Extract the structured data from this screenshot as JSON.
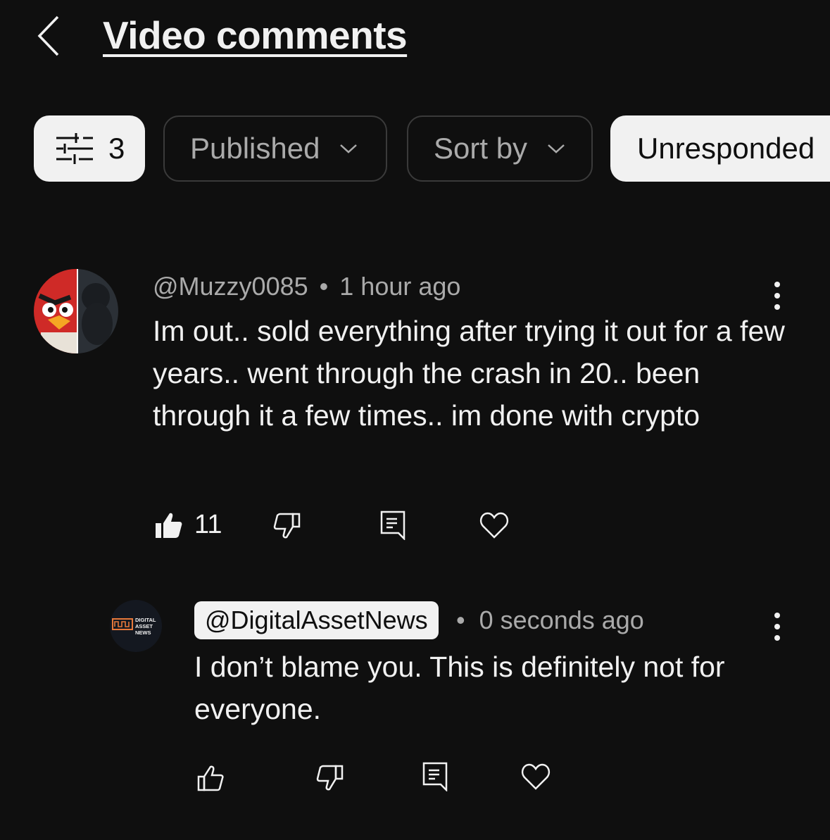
{
  "header": {
    "title": "Video comments"
  },
  "filters": {
    "filter_count": "3",
    "published_label": "Published",
    "sort_label": "Sort by",
    "unresponded_label": "Unresponded"
  },
  "comments": [
    {
      "author": "@Muzzy0085",
      "separator": "•",
      "time": "1 hour ago",
      "text": "Im out.. sold everything after trying it out for a few years.. went through the crash in 20.. been through it a few times.. im done with crypto",
      "like_count": "11"
    }
  ],
  "reply": {
    "author": "@DigitalAssetNews",
    "separator": "•",
    "time": "0 seconds ago",
    "text": "I don’t blame you. This is definitely not for everyone.",
    "avatar_logo_text": [
      "DIGITAL",
      "ASSET",
      "NEWS"
    ]
  },
  "colors": {
    "background": "#0f0f0f",
    "chip_light": "#f1f1f1",
    "muted_text": "#aaaaaa",
    "logo_orange": "#e8793a"
  },
  "icons": [
    "back-icon",
    "filter-sliders-icon",
    "chevron-down-icon",
    "more-vert-icon",
    "thumb-up-icon",
    "thumb-down-icon",
    "reply-icon",
    "heart-icon"
  ]
}
